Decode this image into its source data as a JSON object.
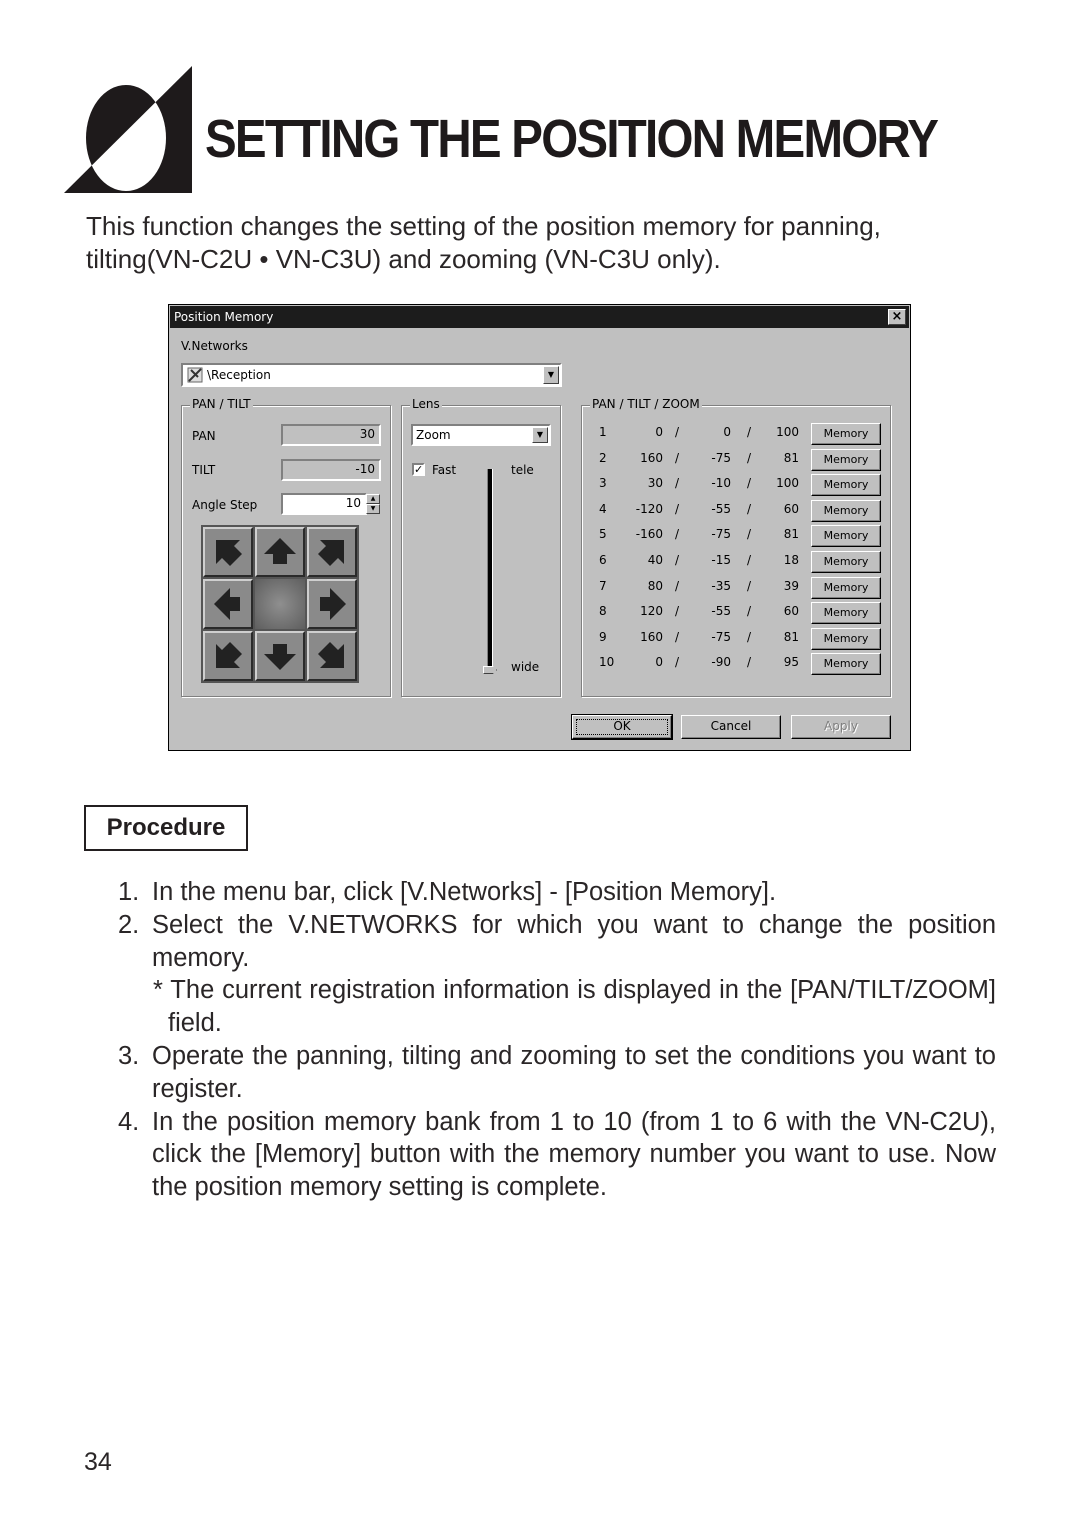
{
  "header": {
    "title": "SETTING THE POSITION MEMORY",
    "intro": "This function changes the setting of the position memory for panning, tilting(VN-C2U • VN-C3U) and zooming (VN-C3U only)."
  },
  "dialog": {
    "title": "Position Memory",
    "close_label": "×",
    "vnetworks_label": "V.Networks",
    "vnetworks_value": "\\Reception",
    "pan_tilt": {
      "legend": "PAN / TILT",
      "pan_label": "PAN",
      "pan_value": "30",
      "tilt_label": "TILT",
      "tilt_value": "-10",
      "angle_step_label": "Angle Step",
      "angle_step_value": "10"
    },
    "lens": {
      "legend": "Lens",
      "mode_value": "Zoom",
      "fast_label": "Fast",
      "fast_checked": true,
      "tele_label": "tele",
      "wide_label": "wide",
      "slider_position": "wide"
    },
    "memory": {
      "legend": "PAN / TILT / ZOOM",
      "button_label": "Memory",
      "separator": "/",
      "rows": [
        {
          "n": "1",
          "pan": "0",
          "tilt": "0",
          "zoom": "100"
        },
        {
          "n": "2",
          "pan": "160",
          "tilt": "-75",
          "zoom": "81"
        },
        {
          "n": "3",
          "pan": "30",
          "tilt": "-10",
          "zoom": "100"
        },
        {
          "n": "4",
          "pan": "-120",
          "tilt": "-55",
          "zoom": "60"
        },
        {
          "n": "5",
          "pan": "-160",
          "tilt": "-75",
          "zoom": "81"
        },
        {
          "n": "6",
          "pan": "40",
          "tilt": "-15",
          "zoom": "18"
        },
        {
          "n": "7",
          "pan": "80",
          "tilt": "-35",
          "zoom": "39"
        },
        {
          "n": "8",
          "pan": "120",
          "tilt": "-55",
          "zoom": "60"
        },
        {
          "n": "9",
          "pan": "160",
          "tilt": "-75",
          "zoom": "81"
        },
        {
          "n": "10",
          "pan": "0",
          "tilt": "-90",
          "zoom": "95"
        }
      ]
    },
    "buttons": {
      "ok": "OK",
      "cancel": "Cancel",
      "apply": "Apply"
    }
  },
  "procedure": {
    "heading": "Procedure",
    "steps": [
      {
        "num": "1.",
        "text": "In the menu bar, click [V.Networks] - [Position Memory]."
      },
      {
        "num": "2.",
        "text": "Select the V.NETWORKS for which you want to change the position memory."
      },
      {
        "num": "3.",
        "text": "Operate the panning, tilting and zooming to set the conditions you want to register."
      },
      {
        "num": "4.",
        "text": "In the position memory bank from 1 to 10 (from 1 to 6 with the VN-C2U), click the [Memory] button with the memory number you want to use. Now the position memory setting is complete."
      }
    ],
    "note": "* The current registration information is displayed in the [PAN/TILT/ZOOM] field."
  },
  "page_number": "34"
}
